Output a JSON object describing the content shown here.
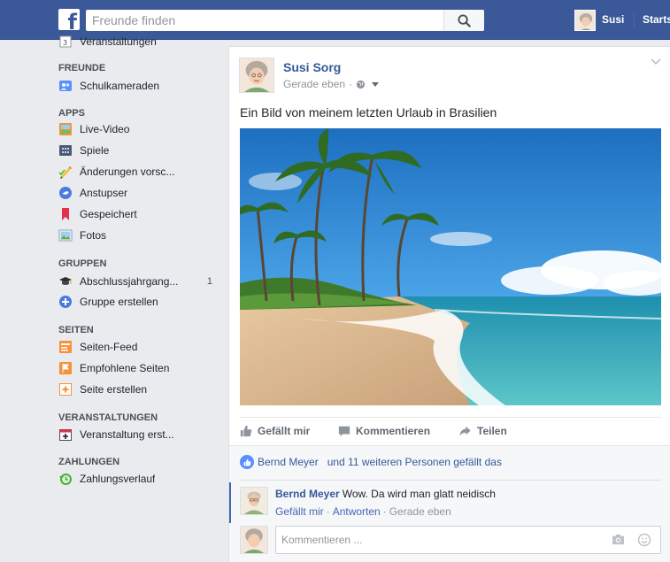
{
  "colors": {
    "brand": "#3b5998",
    "link": "#365899",
    "background": "#e9ebee"
  },
  "topbar": {
    "logo": "f",
    "search_placeholder": "Freunde finden",
    "user_name": "Susi",
    "start_label": "Startseite"
  },
  "sidebar": {
    "partial_item": "Veranstaltungen",
    "sections": {
      "freunde": "FREUNDE",
      "apps": "APPS",
      "gruppen": "GRUPPEN",
      "seiten": "SEITEN",
      "veranstaltungen": "VERANSTALTUNGEN",
      "zahlungen": "ZAHLUNGEN"
    },
    "items": {
      "schulkameraden": "Schulkameraden",
      "live_video": "Live-Video",
      "spiele": "Spiele",
      "aenderungen": "Änderungen vorsc...",
      "anstupser": "Anstupser",
      "gespeichert": "Gespeichert",
      "fotos": "Fotos",
      "abschluss": "Abschlussjahrgang...",
      "abschluss_count": "1",
      "gruppe_erstellen": "Gruppe erstellen",
      "seiten_feed": "Seiten-Feed",
      "empfohlene": "Empfohlene Seiten",
      "seite_erstellen": "Seite erstellen",
      "veranstaltung_erst": "Veranstaltung erst...",
      "zahlungsverlauf": "Zahlungsverlauf"
    }
  },
  "post": {
    "author": "Susi Sorg",
    "time": "Gerade eben",
    "dot": "·",
    "text": "Ein Bild von meinem letzten Urlaub in Brasilien",
    "actions": {
      "like": "Gefällt mir",
      "comment": "Kommentieren",
      "share": "Teilen"
    },
    "likes": {
      "name": "Bernd Meyer",
      "rest": "und 11 weiteren Personen gefällt das"
    },
    "comment": {
      "author": "Bernd Meyer",
      "text": "Wow. Da wird man glatt neidisch",
      "like": "Gefällt mir",
      "reply": "Antworten",
      "sep": "·",
      "time": "Gerade eben"
    },
    "comment_placeholder": "Kommentieren ..."
  }
}
